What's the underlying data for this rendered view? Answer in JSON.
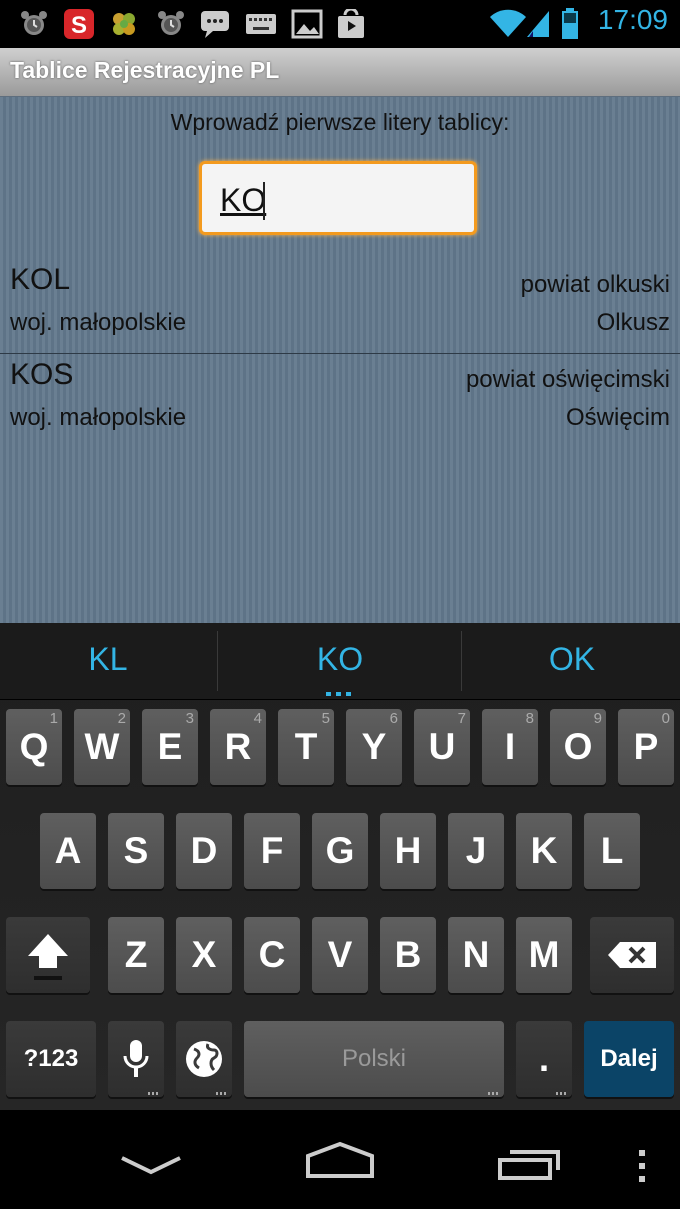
{
  "status_bar": {
    "time": "17:09",
    "icons": [
      "alarm-icon",
      "sport-app-icon",
      "flower-app-icon",
      "alarm-icon",
      "message-icon",
      "keyboard-icon",
      "gallery-icon",
      "play-store-icon",
      "wifi-icon",
      "signal-icon",
      "battery-icon"
    ],
    "accent_color": "#33b5e5"
  },
  "app": {
    "title": "Tablice Rejestracyjne PL",
    "prompt": "Wprowadź pierwsze litery tablicy:",
    "input_value": "KO"
  },
  "results": [
    {
      "code": "KOL",
      "powiat": "powiat olkuski",
      "woj": "woj. małopolskie",
      "city": "Olkusz"
    },
    {
      "code": "KOS",
      "powiat": "powiat oświęcimski",
      "woj": "woj. małopolskie",
      "city": "Oświęcim"
    }
  ],
  "keyboard": {
    "suggestions": [
      "KL",
      "KO",
      "OK"
    ],
    "row1": [
      "Q",
      "W",
      "E",
      "R",
      "T",
      "Y",
      "U",
      "I",
      "O",
      "P"
    ],
    "row1_hints": [
      "1",
      "2",
      "3",
      "4",
      "5",
      "6",
      "7",
      "8",
      "9",
      "0"
    ],
    "row2": [
      "A",
      "S",
      "D",
      "F",
      "G",
      "H",
      "J",
      "K",
      "L"
    ],
    "row3": [
      "Z",
      "X",
      "C",
      "V",
      "B",
      "N",
      "M"
    ],
    "symbols_label": "?123",
    "space_label": "Polski",
    "period_label": ".",
    "enter_label": "Dalej"
  },
  "colors": {
    "content_bg": "#62788c",
    "input_border": "#f39a1e",
    "enter_key": "#0b4467"
  }
}
